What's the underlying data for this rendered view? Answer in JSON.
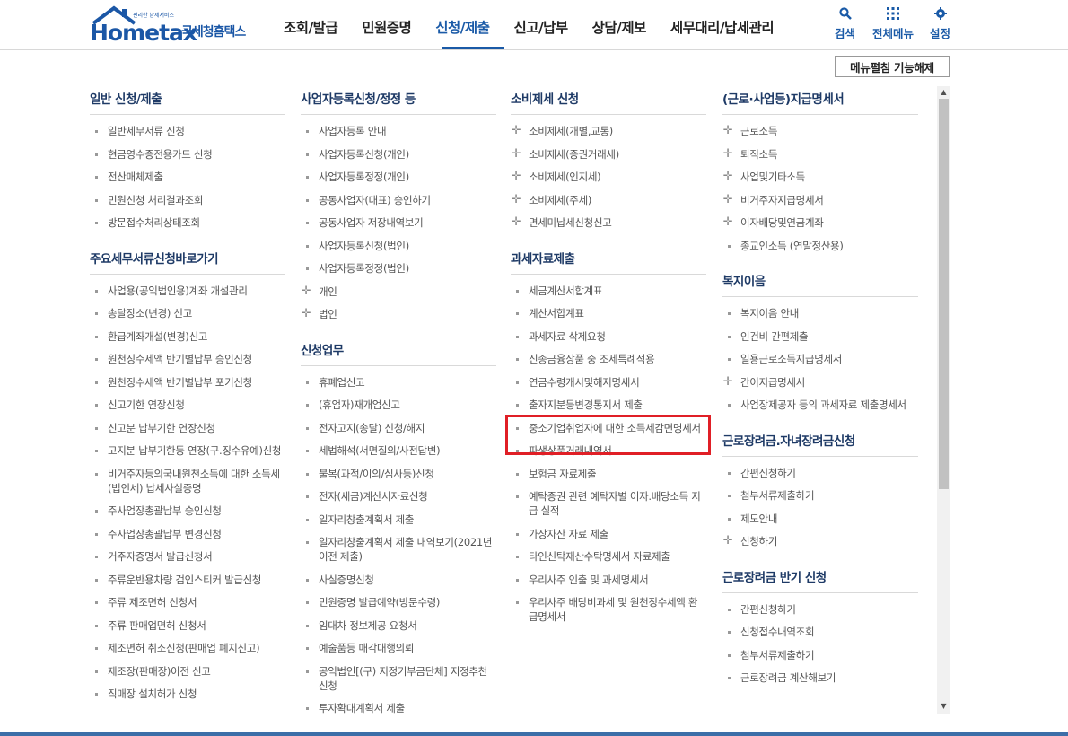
{
  "logo": {
    "main": "Hometax",
    "sub": "국세청홈택스",
    "tag": "편리한 납세서비스"
  },
  "gnb": [
    {
      "label": "조회/발급",
      "active": false
    },
    {
      "label": "민원증명",
      "active": false
    },
    {
      "label": "신청/제출",
      "active": true
    },
    {
      "label": "신고/납부",
      "active": false
    },
    {
      "label": "상담/제보",
      "active": false
    },
    {
      "label": "세무대리/납세관리",
      "active": false
    }
  ],
  "util": {
    "search": "검색",
    "all_menu": "전체메뉴",
    "settings": "설정"
  },
  "fold_button": "메뉴펼침 기능해제",
  "columns": [
    {
      "sections": [
        {
          "title": "일반 신청/제출",
          "items": [
            {
              "label": "일반세무서류 신청"
            },
            {
              "label": "현금영수증전용카드 신청"
            },
            {
              "label": "전산매체제출"
            },
            {
              "label": "민원신청 처리결과조회"
            },
            {
              "label": "방문접수처리상태조회"
            }
          ]
        },
        {
          "title": "주요세무서류신청바로가기",
          "items": [
            {
              "label": "사업용(공익법인용)계좌 개설관리"
            },
            {
              "label": "송달장소(변경) 신고"
            },
            {
              "label": "환급계좌개설(변경)신고"
            },
            {
              "label": "원천징수세액 반기별납부 승인신청"
            },
            {
              "label": "원천징수세액 반기별납부 포기신청"
            },
            {
              "label": "신고기한 연장신청"
            },
            {
              "label": "신고분 납부기한 연장신청"
            },
            {
              "label": "고지분 납부기한등 연장(구.징수유예)신청"
            },
            {
              "label": "비거주자등의국내원천소득에 대한 소득세(법인세) 납세사실증명"
            },
            {
              "label": "주사업장총괄납부 승인신청"
            },
            {
              "label": "주사업장총괄납부 변경신청"
            },
            {
              "label": "거주자증명서 발급신청서"
            },
            {
              "label": "주류운반용차량 검인스티커 발급신청"
            },
            {
              "label": "주류 제조면허 신청서"
            },
            {
              "label": "주류 판매업면허 신청서"
            },
            {
              "label": "제조면허 취소신청(판매업 폐지신고)"
            },
            {
              "label": "제조장(판매장)이전 신고"
            },
            {
              "label": "직매장 설치허가 신청"
            }
          ]
        }
      ]
    },
    {
      "sections": [
        {
          "title": "사업자등록신청/정정 등",
          "items": [
            {
              "label": "사업자등록 안내"
            },
            {
              "label": "사업자등록신청(개인)"
            },
            {
              "label": "사업자등록정정(개인)"
            },
            {
              "label": "공동사업자(대표) 승인하기"
            },
            {
              "label": "공동사업자 저장내역보기"
            },
            {
              "label": "사업자등록신청(법인)"
            },
            {
              "label": "사업자등록정정(법인)"
            },
            {
              "label": "개인",
              "plus": true
            },
            {
              "label": "법인",
              "plus": true
            }
          ]
        },
        {
          "title": "신청업무",
          "items": [
            {
              "label": "휴폐업신고"
            },
            {
              "label": "(휴업자)재개업신고"
            },
            {
              "label": "전자고지(송달) 신청/해지"
            },
            {
              "label": "세법해석(서면질의/사전답변)"
            },
            {
              "label": "불복(과적/이의/심사등)신청"
            },
            {
              "label": "전자(세금)계산서자료신청"
            },
            {
              "label": "일자리창출계획서 제출"
            },
            {
              "label": "일자리창출계획서 제출 내역보기(2021년 이전 제출)"
            },
            {
              "label": "사실증명신청"
            },
            {
              "label": "민원증명 발급예약(방문수령)"
            },
            {
              "label": "임대차 정보제공 요청서"
            },
            {
              "label": "예술품등 매각대행의뢰"
            },
            {
              "label": "공익법인[(구) 지정기부금단체] 지정추천 신청"
            },
            {
              "label": "투자확대계획서 제출"
            }
          ]
        }
      ]
    },
    {
      "sections": [
        {
          "title": "소비제세 신청",
          "items": [
            {
              "label": "소비제세(개별,교통)",
              "plus": true
            },
            {
              "label": "소비제세(증권거래세)",
              "plus": true
            },
            {
              "label": "소비제세(인지세)",
              "plus": true
            },
            {
              "label": "소비제세(주세)",
              "plus": true
            },
            {
              "label": "면세미납세신청신고",
              "plus": true
            }
          ]
        },
        {
          "title": "과세자료제출",
          "items": [
            {
              "label": "세금계산서합계표"
            },
            {
              "label": "계산서합계표"
            },
            {
              "label": "과세자료 삭제요청"
            },
            {
              "label": "신종금융상품 중 조세특례적용"
            },
            {
              "label": "연금수령개시및해지명세서"
            },
            {
              "label": "출자지분등변경통지서 제출"
            },
            {
              "label": "중소기업취업자에 대한 소득세감면명세서"
            },
            {
              "label": "파생상품거래내역서"
            },
            {
              "label": "보험금 자료제출"
            },
            {
              "label": "예탁증권 관련 예탁자별 이자.배당소득 지급 실적"
            },
            {
              "label": "가상자산 자료 제출"
            },
            {
              "label": "타인신탁재산수탁명세서 자료제출"
            },
            {
              "label": "우리사주 인출 및 과세명세서"
            },
            {
              "label": "우리사주 배당비과세 및 원천징수세액 환급명세서"
            }
          ]
        }
      ]
    },
    {
      "sections": [
        {
          "title": "(근로·사업등)지급명세서",
          "items": [
            {
              "label": "근로소득",
              "plus": true
            },
            {
              "label": "퇴직소득",
              "plus": true
            },
            {
              "label": "사업및기타소득",
              "plus": true
            },
            {
              "label": "비거주자지급명세서",
              "plus": true
            },
            {
              "label": "이자배당및연금계좌",
              "plus": true
            },
            {
              "label": "종교인소득 (연말정산용)"
            }
          ]
        },
        {
          "title": "복지이음",
          "items": [
            {
              "label": "복지이음 안내"
            },
            {
              "label": "인건비 간편제출"
            },
            {
              "label": "일용근로소득지급명세서"
            },
            {
              "label": "간이지급명세서",
              "plus": true
            },
            {
              "label": "사업장제공자 등의 과세자료 제출명세서"
            }
          ]
        },
        {
          "title": "근로장려금.자녀장려금신청",
          "items": [
            {
              "label": "간편신청하기"
            },
            {
              "label": "첨부서류제출하기"
            },
            {
              "label": "제도안내"
            },
            {
              "label": "신청하기",
              "plus": true
            }
          ]
        },
        {
          "title": "근로장려금 반기 신청",
          "items": [
            {
              "label": "간편신청하기"
            },
            {
              "label": "신청접수내역조회"
            },
            {
              "label": "첨부서류제출하기"
            },
            {
              "label": "근로장려금 계산해보기"
            }
          ]
        }
      ]
    }
  ]
}
